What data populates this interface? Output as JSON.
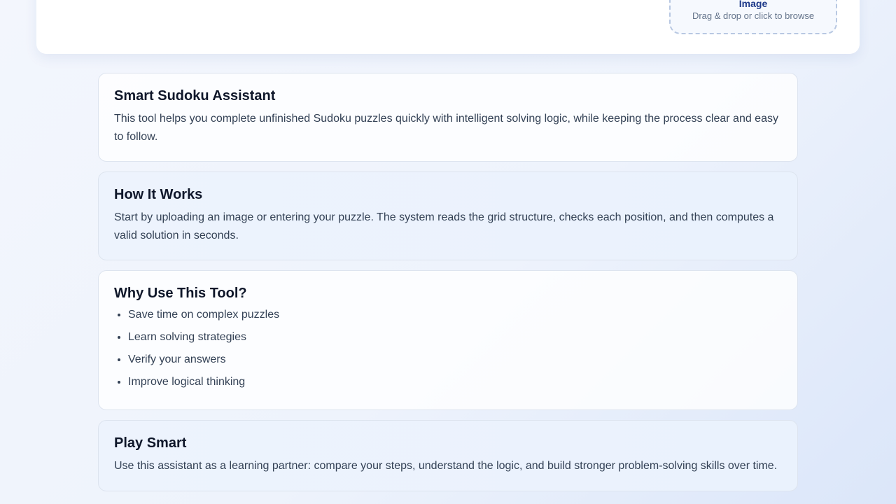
{
  "upload": {
    "title": "Image",
    "hint": "Drag & drop or click to browse"
  },
  "sections": {
    "assistant": {
      "title": "Smart Sudoku Assistant",
      "body": "This tool helps you complete unfinished Sudoku puzzles quickly with intelligent solving logic, while keeping the process clear and easy to follow."
    },
    "how": {
      "title": "How It Works",
      "body": "Start by uploading an image or entering your puzzle. The system reads the grid structure, checks each position, and then computes a valid solution in seconds."
    },
    "why": {
      "title": "Why Use This Tool?",
      "items": [
        "Save time on complex puzzles",
        "Learn solving strategies",
        "Verify your answers",
        "Improve logical thinking"
      ]
    },
    "play": {
      "title": "Play Smart",
      "body": "Use this assistant as a learning partner: compare your steps, understand the logic, and build stronger problem-solving skills over time."
    }
  }
}
